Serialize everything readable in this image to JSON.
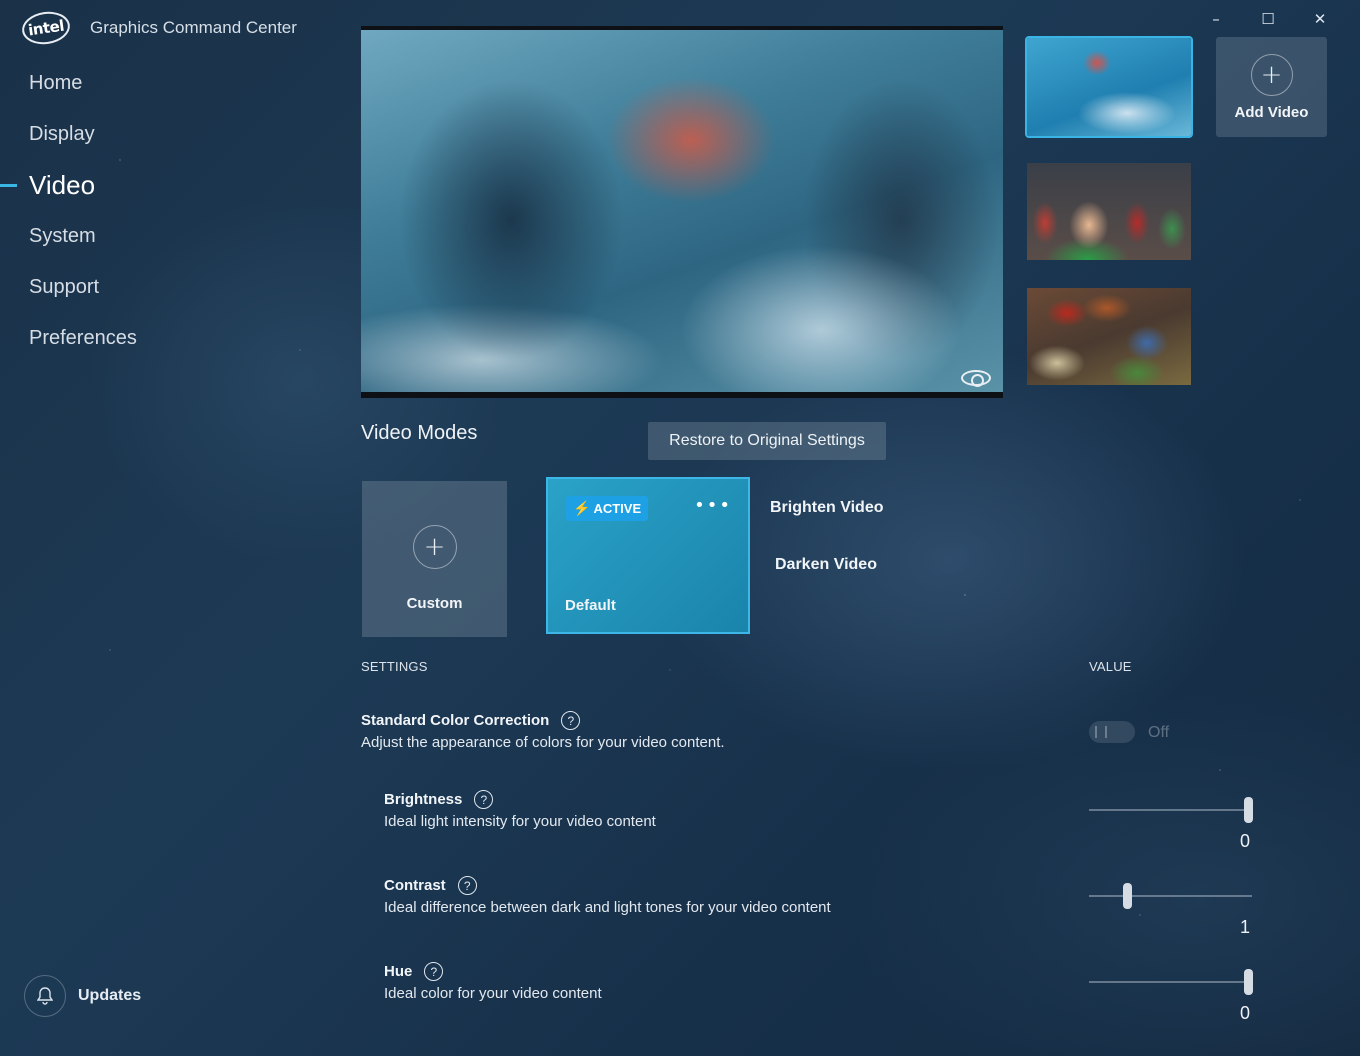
{
  "window": {
    "minimize": "–",
    "maximize": "☐",
    "close": "✕"
  },
  "brand": {
    "logo": "intel",
    "title": "Graphics Command Center"
  },
  "nav": {
    "items": [
      {
        "label": "Home",
        "active": false
      },
      {
        "label": "Display",
        "active": false
      },
      {
        "label": "Video",
        "active": true
      },
      {
        "label": "System",
        "active": false
      },
      {
        "label": "Support",
        "active": false
      },
      {
        "label": "Preferences",
        "active": false
      }
    ],
    "updates_label": "Updates"
  },
  "gallery": {
    "add_video_label": "Add Video",
    "thumbnails": [
      "snowboarder",
      "group-of-people",
      "market-produce"
    ],
    "selected_index": 0
  },
  "video_modes": {
    "title": "Video Modes",
    "restore_label": "Restore to Original Settings",
    "custom_label": "Custom",
    "active_badge": "ACTIVE",
    "more_label": "•••",
    "default_label": "Default",
    "brighten_label": "Brighten Video",
    "darken_label": "Darken Video"
  },
  "settings": {
    "header": "SETTINGS",
    "value_header": "VALUE",
    "color_correction": {
      "name": "Standard Color Correction",
      "desc": "Adjust the appearance of colors for your video content.",
      "state": "Off",
      "enabled": false
    },
    "brightness": {
      "name": "Brightness",
      "desc": "Ideal light intensity for your video content",
      "value": "0",
      "fraction": 1.0
    },
    "contrast": {
      "name": "Contrast",
      "desc": "Ideal difference between dark and light tones for your video content",
      "value": "1",
      "fraction": 0.22
    },
    "hue": {
      "name": "Hue",
      "desc": "Ideal color for your video content",
      "value": "0",
      "fraction": 1.0
    },
    "help_glyph": "?"
  },
  "colors": {
    "accent": "#39b5e6",
    "active_card": "#1a84ab"
  }
}
